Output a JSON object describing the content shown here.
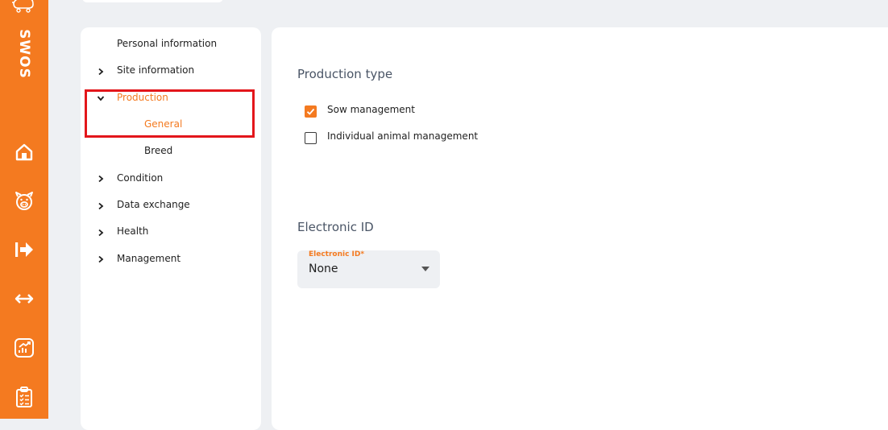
{
  "app": {
    "brand": "SWOS",
    "accent_color": "#f47a20",
    "rail_icons": [
      "pig-cart-logo-icon",
      "home-icon",
      "pig-face-icon",
      "exit-arrow-icon",
      "transfer-arrows-icon",
      "chart-icon",
      "clipboard-icon"
    ]
  },
  "sidebar": {
    "items": [
      {
        "label": "Personal information",
        "expandable": false,
        "expanded": false,
        "active": false
      },
      {
        "label": "Site information",
        "expandable": true,
        "expanded": false,
        "active": false
      },
      {
        "label": "Production",
        "expandable": true,
        "expanded": true,
        "active": true
      },
      {
        "label": "General",
        "expandable": false,
        "expanded": false,
        "active": true,
        "child": true
      },
      {
        "label": "Breed",
        "expandable": false,
        "expanded": false,
        "active": false,
        "child": true
      },
      {
        "label": "Condition",
        "expandable": true,
        "expanded": false,
        "active": false
      },
      {
        "label": "Data exchange",
        "expandable": true,
        "expanded": false,
        "active": false
      },
      {
        "label": "Health",
        "expandable": true,
        "expanded": false,
        "active": false
      },
      {
        "label": "Management",
        "expandable": true,
        "expanded": false,
        "active": false
      }
    ],
    "highlight_color": "#e3161b"
  },
  "main": {
    "production_type": {
      "title": "Production type",
      "options": [
        {
          "label": "Sow management",
          "checked": true
        },
        {
          "label": "Individual animal management",
          "checked": false
        }
      ]
    },
    "electronic_id": {
      "title": "Electronic ID",
      "field_label": "Electronic ID*",
      "value": "None"
    }
  }
}
